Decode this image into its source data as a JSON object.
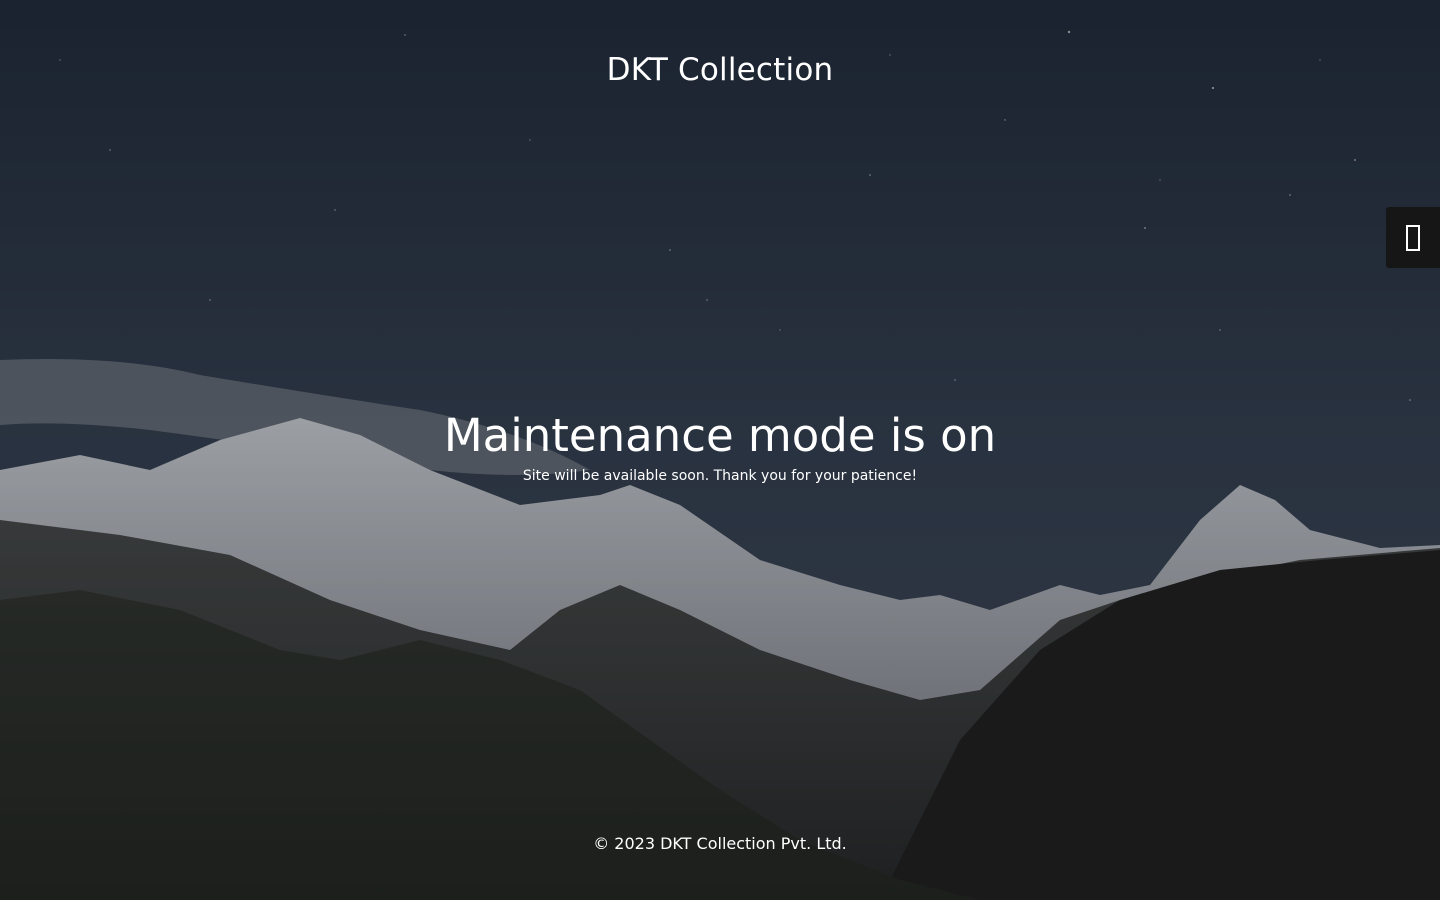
{
  "site": {
    "title": "DKT Collection"
  },
  "hero": {
    "heading": "Maintenance mode is on",
    "subtext": "Site will be available soon. Thank you for your patience!"
  },
  "footer": {
    "copyright": "© 2023 DKT Collection Pvt. Ltd."
  },
  "side_tab": {
    "icon": "login-icon"
  },
  "colors": {
    "text": "#ffffff",
    "side_tab_bg": "#161616"
  }
}
